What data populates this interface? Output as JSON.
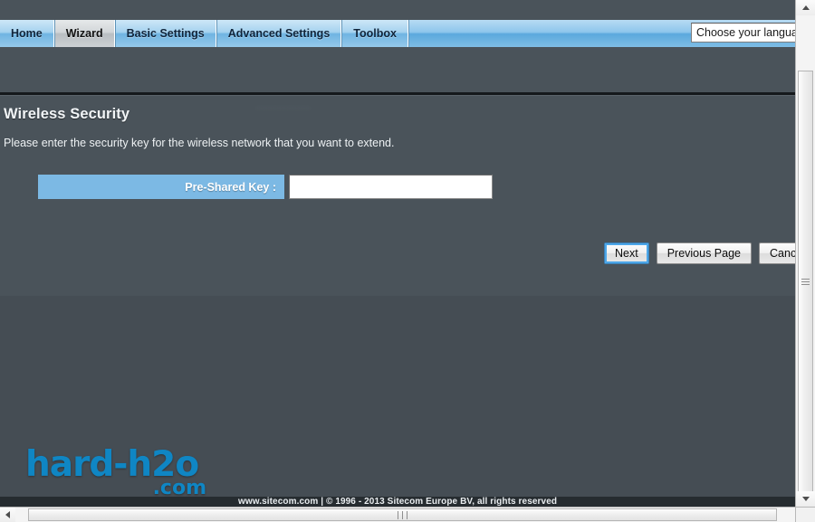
{
  "nav": {
    "tabs": [
      {
        "label": "Home",
        "active": false
      },
      {
        "label": "Wizard",
        "active": true
      },
      {
        "label": "Basic Settings",
        "active": false
      },
      {
        "label": "Advanced Settings",
        "active": false
      },
      {
        "label": "Toolbox",
        "active": false
      }
    ]
  },
  "language": {
    "selected": "Choose your language",
    "icon": "chevron-down-icon"
  },
  "page": {
    "title": "Wireless Security",
    "description": "Please enter the security key for the wireless network that you want to extend."
  },
  "form": {
    "pre_shared_key": {
      "label": "Pre-Shared Key :",
      "value": "············",
      "placeholder": "",
      "obscured": true
    }
  },
  "buttons": [
    {
      "label": "Next",
      "focused": true
    },
    {
      "label": "Previous Page",
      "focused": false
    },
    {
      "label": "Cancel",
      "focused": false
    }
  ],
  "watermark": {
    "main": "hard-h2o",
    "sub": ".com",
    "color": "#0f86c4"
  },
  "footer": {
    "text": "www.sitecom.com | © 1996 - 2013 Sitecom Europe BV, all rights reserved"
  },
  "scrollbars": {
    "vertical": {
      "up_icon": "triangle-up-icon",
      "down_icon": "triangle-down-icon"
    },
    "horizontal": {
      "left_icon": "triangle-left-icon",
      "right_icon": "triangle-right-icon"
    }
  },
  "colors": {
    "page_bg": "#4a535a",
    "tab_blue": "#8ec6ec",
    "label_blue": "#7cb9e4",
    "footer_bg": "#262c30",
    "accent": "#4ca6e8"
  }
}
